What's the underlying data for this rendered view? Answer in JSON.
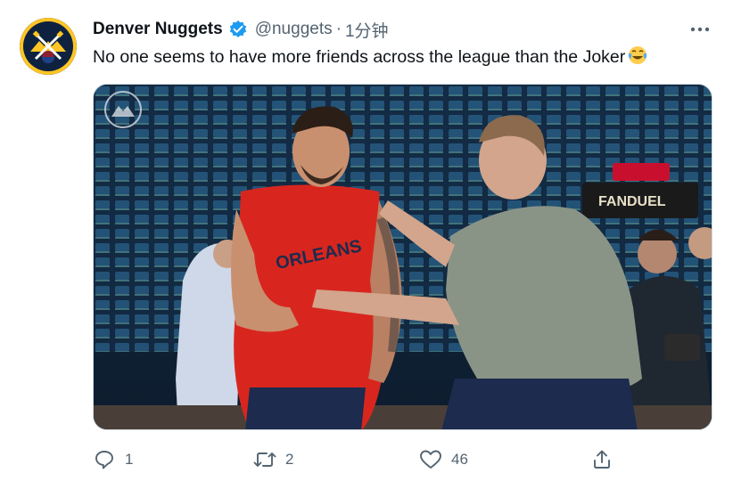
{
  "tweet": {
    "author_name": "Denver Nuggets",
    "handle": "@nuggets",
    "separator": "·",
    "time": "1分钟",
    "text": "No one seems to have more friends across the league than the Joker",
    "emoji": "face-with-tears-of-joy"
  },
  "media": {
    "description_icon": "photo",
    "jersey_text": "ORLEANS",
    "sign_text": "FANDUEL"
  },
  "actions": {
    "reply_count": "1",
    "retweet_count": "2",
    "like_count": "46",
    "share_icon": "share-icon"
  },
  "colors": {
    "brand_navy": "#0e2240",
    "brand_gold": "#fec524",
    "verified_blue": "#1d9bf0",
    "secondary_text": "#536471"
  }
}
